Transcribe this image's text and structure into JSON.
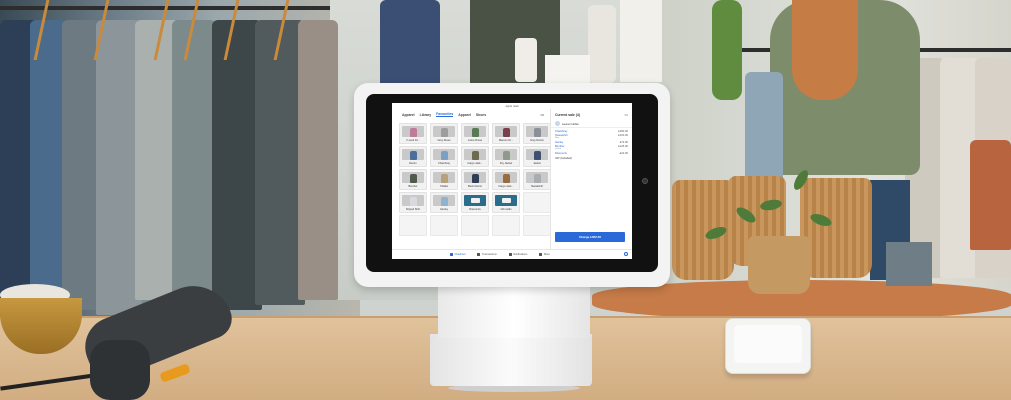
{
  "pos": {
    "top_title": "Apple retail",
    "tabs": [
      {
        "label": "Apparel",
        "active": false
      },
      {
        "label": "Library",
        "active": false
      },
      {
        "label": "Favourites",
        "active": true
      },
      {
        "label": "Apparel",
        "active": false
      },
      {
        "label": "Shoes",
        "active": false
      }
    ],
    "tabs_more": "•••",
    "tiles": [
      {
        "label": "V-neck Dr...",
        "color": "#c07a9a"
      },
      {
        "label": "Grey Dress",
        "color": "#9d9d9d"
      },
      {
        "label": "A-line Dress",
        "color": "#5a7a55"
      },
      {
        "label": "Maroon Dr...",
        "color": "#7a3f4a"
      },
      {
        "label": "Grey Denim",
        "color": "#8a8f99"
      },
      {
        "label": "Denim",
        "color": "#4d6e9c"
      },
      {
        "label": "Chambray",
        "color": "#7ba0c4"
      },
      {
        "label": "Cargo Jack...",
        "color": "#6b6b4f"
      },
      {
        "label": "Dry Jacket",
        "color": "#8f9b8a"
      },
      {
        "label": "Jacket",
        "color": "#3f5070"
      },
      {
        "label": "Bomber",
        "color": "#4f5b4a"
      },
      {
        "label": "Khakis",
        "color": "#b7a07a"
      },
      {
        "label": "Buck Denim",
        "color": "#2f3d55"
      },
      {
        "label": "Cargo Jack...",
        "color": "#9a6b3f"
      },
      {
        "label": "Sweatshirt",
        "color": "#a9adb2"
      },
      {
        "label": "Striped Shirt",
        "color": "#d9d9df"
      },
      {
        "label": "Henley",
        "color": "#8fb2cf"
      }
    ],
    "dark_tiles": [
      {
        "label": "Discounts",
        "icon": "tag-icon"
      },
      {
        "label": "Gift cards",
        "icon": "gift-card-icon"
      }
    ],
    "ticket": {
      "title": "Current sale (4)",
      "more": "•••",
      "customer": "Lauren Noble",
      "lines": [
        {
          "name": "Chambray",
          "sub": "",
          "price": "£180.00"
        },
        {
          "name": "Sweatshirt",
          "sub": "Blue",
          "price": "£100.00"
        },
        {
          "name": "Henley",
          "sub": "",
          "price": "£72.00"
        },
        {
          "name": "Bomber",
          "sub": "Green",
          "price": "£125.00"
        },
        {
          "name": "Discounts",
          "sub": "",
          "price": "-£22.00"
        }
      ],
      "vat": "VAT (Included)",
      "charge_label": "Charge £352.00"
    },
    "bottom_nav": [
      {
        "label": "Checkout",
        "icon": "checkout-icon",
        "active": true
      },
      {
        "label": "Transactions",
        "icon": "transactions-icon",
        "active": false
      },
      {
        "label": "Notifications",
        "icon": "bell-icon",
        "active": false
      },
      {
        "label": "More",
        "icon": "menu-icon",
        "active": false
      }
    ]
  }
}
